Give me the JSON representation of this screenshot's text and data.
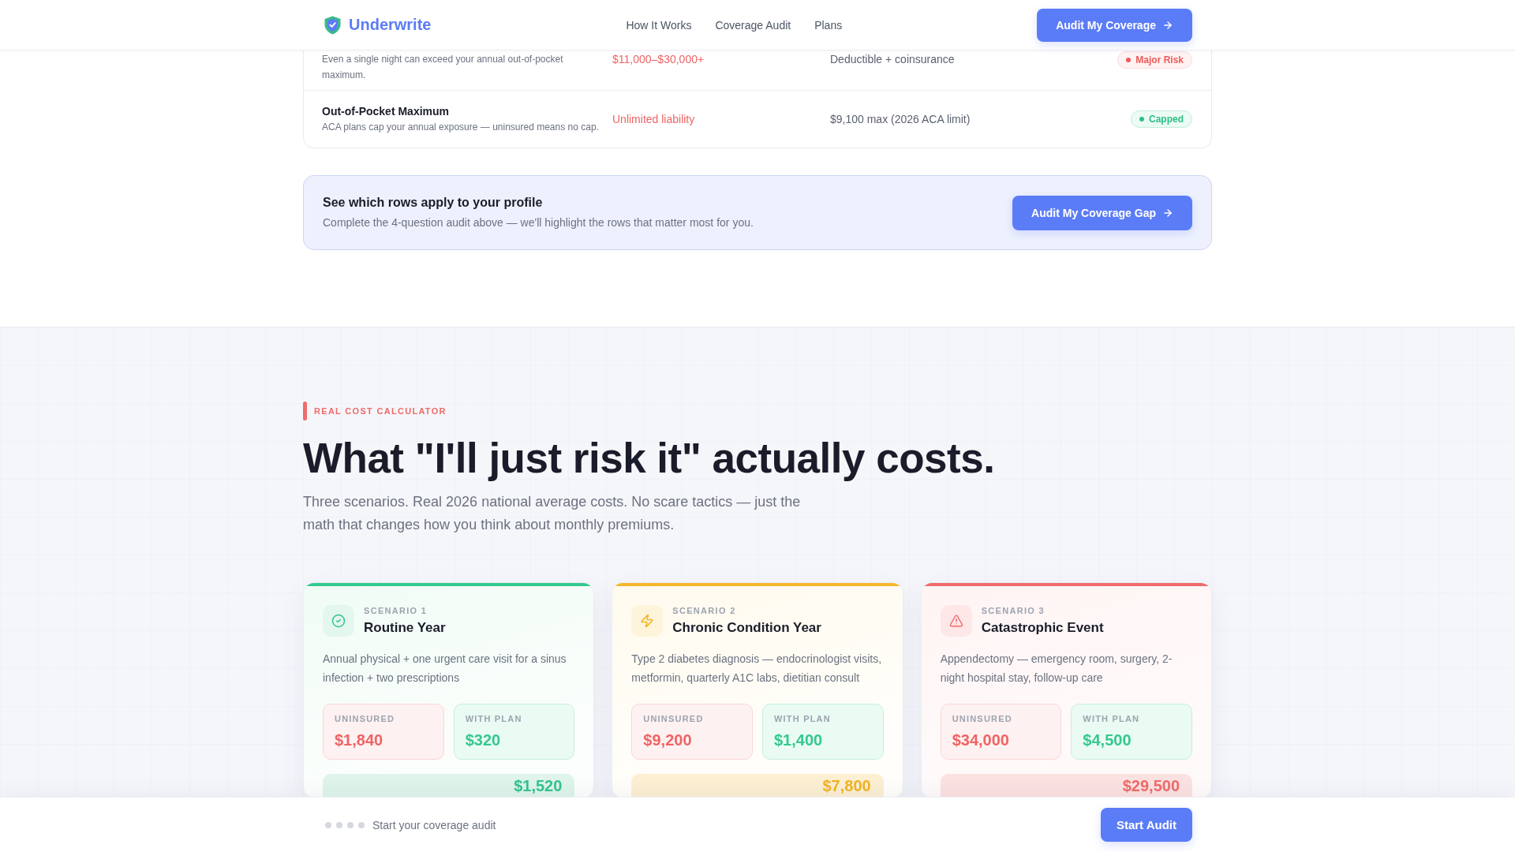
{
  "nav": {
    "brand": "Underwrite",
    "links": [
      "How It Works",
      "Coverage Audit",
      "Plans"
    ],
    "cta": "Audit My Coverage"
  },
  "comparison_table": {
    "rows": [
      {
        "description": "Even a single night can exceed your annual out-of-pocket maximum.",
        "uninsured": "$11,000–$30,000+",
        "with_plan": "Deductible + coinsurance",
        "badge": {
          "kind": "risk",
          "label": "Major Risk"
        }
      },
      {
        "title": "Out-of-Pocket Maximum",
        "description": "ACA plans cap your annual exposure — uninsured means no cap.",
        "uninsured": "Unlimited liability",
        "with_plan": "$9,100 max (2026 ACA limit)",
        "badge": {
          "kind": "capped",
          "label": "Capped"
        }
      }
    ]
  },
  "profile_banner": {
    "title": "See which rows apply to your profile",
    "text": "Complete the 4-question audit above — we'll highlight the rows that matter most for you.",
    "button": "Audit My Coverage Gap"
  },
  "calculator": {
    "eyebrow": "REAL COST CALCULATOR",
    "heading": "What \"I'll just risk it\" actually costs.",
    "intro": "Three scenarios. Real 2026 national average costs. No scare tactics — just the math that changes how you think about monthly premiums.",
    "scenarios": [
      {
        "kind": "success",
        "color": "#34c98e",
        "label": "SCENARIO 1",
        "title": "Routine Year",
        "description": "Annual physical + one urgent care visit for a sinus infection + two prescriptions",
        "uninsured": {
          "label": "UNINSURED",
          "amount": "$1,840"
        },
        "with_plan": {
          "label": "WITH PLAN",
          "amount": "$320"
        },
        "difference": "$1,520"
      },
      {
        "kind": "warning",
        "color": "#f5b82e",
        "label": "SCENARIO 2",
        "title": "Chronic Condition Year",
        "description": "Type 2 diabetes diagnosis — endocrinologist visits, metformin, quarterly A1C labs, dietitian consult",
        "uninsured": {
          "label": "UNINSURED",
          "amount": "$9,200"
        },
        "with_plan": {
          "label": "WITH PLAN",
          "amount": "$1,400"
        },
        "difference": "$7,800"
      },
      {
        "kind": "danger",
        "color": "#ef6b6b",
        "label": "SCENARIO 3",
        "title": "Catastrophic Event",
        "description": "Appendectomy — emergency room, surgery, 2-night hospital stay, follow-up care",
        "uninsured": {
          "label": "UNINSURED",
          "amount": "$34,000"
        },
        "with_plan": {
          "label": "WITH PLAN",
          "amount": "$4,500"
        },
        "difference": "$29,500"
      }
    ]
  },
  "bottom_bar": {
    "steps": [
      {
        "done": false
      },
      {
        "done": false
      },
      {
        "done": false
      },
      {
        "done": false
      }
    ],
    "text": "Start your coverage audit",
    "button": "Start Audit"
  }
}
